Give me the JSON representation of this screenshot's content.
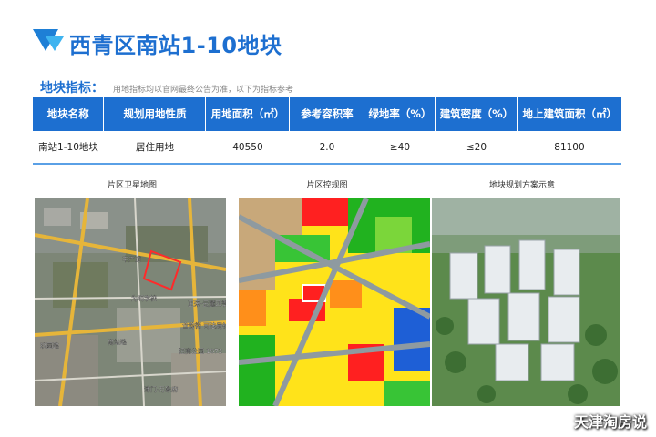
{
  "header": {
    "title": "西青区南站1-10地块"
  },
  "indicators": {
    "label": "地块指标：",
    "note": "用地指标均以官网最终公告为准，以下为指标参考"
  },
  "table": {
    "headers": [
      "地块名称",
      "规划用地性质",
      "用地面积（㎡）",
      "参考容积率",
      "绿地率（%）",
      "建筑密度（%）",
      "地上建筑面积（㎡）"
    ],
    "rows": [
      [
        "南站1-10地块",
        "居住用地",
        "40550",
        "2.0",
        "≥40",
        "≤20",
        "81100"
      ]
    ]
  },
  "captions": [
    "片区卫星地图",
    "片区控规图",
    "地块规划方案示意"
  ],
  "map_labels": {
    "road1": "丰产道",
    "school": "为明学校",
    "mall": "正荣·云麓四季",
    "venue": "含韵街\n司法局社区",
    "park": "招商公园\n1872",
    "east": "玖园路",
    "north": "南站路",
    "south": "津门·万象府"
  },
  "watermark": "天津淘房说",
  "colors": {
    "primary": "#1d6fd0",
    "accent": "#3fb4f0"
  }
}
